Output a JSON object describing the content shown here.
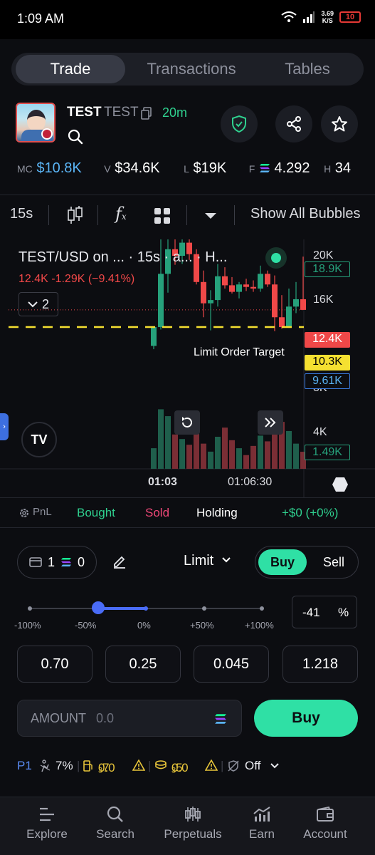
{
  "status_bar": {
    "time": "1:09 AM",
    "net_speed_value": "3.69",
    "net_speed_unit": "K/S",
    "battery": "10"
  },
  "tabs": [
    "Trade",
    "Transactions",
    "Tables"
  ],
  "token": {
    "name": "TEST",
    "symbol": "TEST",
    "age": "20m"
  },
  "stats": {
    "mc_label": "MC",
    "mc_value": "$10.8K",
    "v_label": "V",
    "v_value": "$34.6K",
    "l_label": "L",
    "l_value": "$19K",
    "f_label": "F",
    "f_value": "4.292",
    "h_label": "H",
    "h_value": "34"
  },
  "chart_toolbar": {
    "interval": "15s",
    "bubbles": "Show All Bubbles"
  },
  "chart": {
    "title": "TEST/USD on ... · 15s · a... · H...",
    "ohlc": "12.4K  -1.29K (−9.41%)",
    "collapse_count": "2",
    "limit_label": "Limit Order Target",
    "axis_labels": [
      "20K",
      "16K",
      "8K",
      "4K"
    ],
    "tags": {
      "high": "18.9K",
      "current": "12.4K",
      "limit": "10.3K",
      "low": "9.61K",
      "volume": "1.49K"
    },
    "time_labels": [
      "01:03",
      "01:06:30"
    ],
    "colors": {
      "up": "#26a17b",
      "down": "#f04848",
      "limit": "#f5e031"
    }
  },
  "chart_data": {
    "type": "candlestick",
    "title": "TEST/USD on ... · 15s · a... · H...",
    "ylim": [
      1000,
      21000
    ],
    "y_ticks": [
      "20K",
      "16K",
      "8K",
      "4K"
    ],
    "x_ticks": [
      "01:03",
      "01:06:30"
    ],
    "limit_order_target": 10300,
    "last_price": 12400,
    "change": -1290,
    "change_pct": -9.41,
    "candles": [
      {
        "o": 8000,
        "h": 10300,
        "l": 7600,
        "c": 10300
      },
      {
        "o": 10300,
        "h": 21000,
        "l": 10000,
        "c": 16800
      },
      {
        "o": 16800,
        "h": 21000,
        "l": 14500,
        "c": 19800
      },
      {
        "o": 19800,
        "h": 21000,
        "l": 17900,
        "c": 19000
      },
      {
        "o": 19000,
        "h": 21000,
        "l": 18000,
        "c": 20600
      },
      {
        "o": 20600,
        "h": 21000,
        "l": 18500,
        "c": 19200
      },
      {
        "o": 19200,
        "h": 19800,
        "l": 15500,
        "c": 15800
      },
      {
        "o": 15800,
        "h": 17200,
        "l": 11500,
        "c": 13200
      },
      {
        "o": 13200,
        "h": 14800,
        "l": 9900,
        "c": 13600
      },
      {
        "o": 13600,
        "h": 18000,
        "l": 12800,
        "c": 16500
      },
      {
        "o": 16500,
        "h": 17600,
        "l": 15000,
        "c": 15400
      },
      {
        "o": 15400,
        "h": 16400,
        "l": 14400,
        "c": 14600
      },
      {
        "o": 14600,
        "h": 15800,
        "l": 13800,
        "c": 15500
      },
      {
        "o": 15500,
        "h": 16200,
        "l": 14700,
        "c": 15200
      },
      {
        "o": 15200,
        "h": 16000,
        "l": 14600,
        "c": 15000
      },
      {
        "o": 15000,
        "h": 17800,
        "l": 14600,
        "c": 16800
      },
      {
        "o": 16800,
        "h": 17200,
        "l": 15200,
        "c": 15500
      },
      {
        "o": 15500,
        "h": 16600,
        "l": 9800,
        "c": 11500
      },
      {
        "o": 11500,
        "h": 14200,
        "l": 10100,
        "c": 10300
      },
      {
        "o": 10300,
        "h": 15000,
        "l": 10200,
        "c": 12800
      },
      {
        "o": 12800,
        "h": 15800,
        "l": 12000,
        "c": 13700
      },
      {
        "o": 13700,
        "h": 18900,
        "l": 12400,
        "c": 12400
      }
    ],
    "volumes": [
      1800,
      5200,
      4600,
      3000,
      2600,
      2100,
      3400,
      2200,
      1500,
      2800,
      3600,
      2500,
      1800,
      1200,
      2000,
      2900,
      2400,
      3700,
      4100,
      3300,
      2200,
      1490
    ]
  },
  "pnl_row": {
    "pnl": "PnL",
    "bought": "Bought",
    "sold": "Sold",
    "holding": "Holding",
    "value": "+$0 (+0%)"
  },
  "order": {
    "wallet_count": "1",
    "sol_count": "0",
    "type": "Limit",
    "buy": "Buy",
    "sell": "Sell",
    "slider_labels": [
      "-100%",
      "-50%",
      "0%",
      "+50%",
      "+100%"
    ],
    "pct_value": "-41",
    "pct_unit": "%",
    "slider_value_pct": -41,
    "presets": [
      "0.70",
      "0.25",
      "0.045",
      "1.218"
    ],
    "amount_label": "AMOUNT",
    "amount_placeholder": "0.0",
    "buy_button": "Buy"
  },
  "settings_row": {
    "profile": "P1",
    "slippage": "7%",
    "priority_fee": "0.0",
    "priority_fee_sub": "3",
    "priority_fee_tail": "7",
    "tip": "0.0",
    "tip_sub": "3",
    "tip_tail": "5",
    "mev": "Off"
  },
  "bottom_nav": [
    "Explore",
    "Search",
    "Perpetuals",
    "Earn",
    "Account"
  ]
}
